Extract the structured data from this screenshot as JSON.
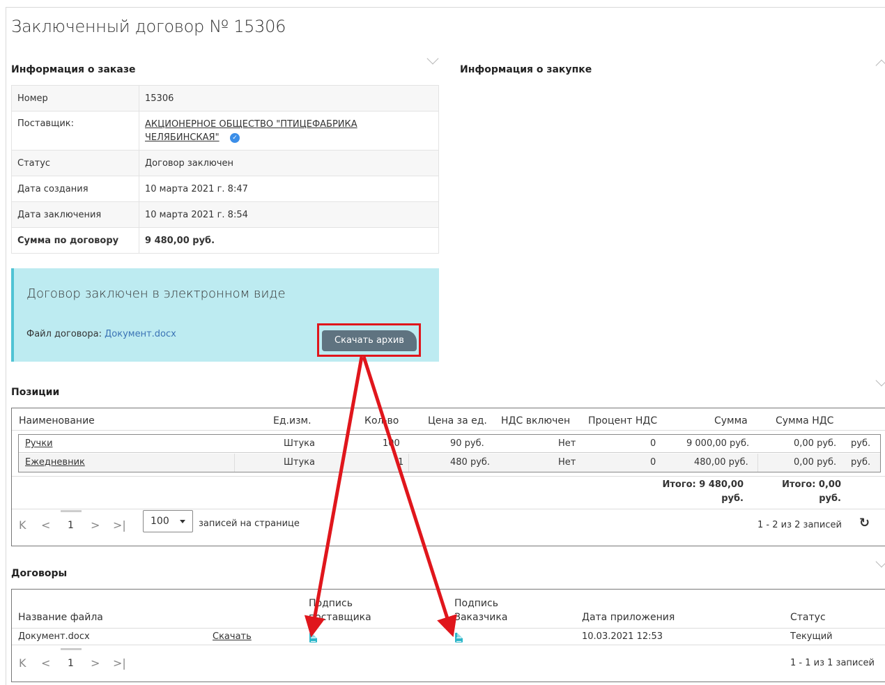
{
  "page": {
    "title": "Заключенный договор № 15306"
  },
  "order_info": {
    "title": "Информация о заказе",
    "rows": [
      {
        "label": "Номер",
        "value": "15306"
      },
      {
        "label": "Поставщик:",
        "value": "АКЦИОНЕРНОЕ ОБЩЕСТВО \"ПТИЦЕФАБРИКА ЧЕЛЯБИНСКАЯ\""
      },
      {
        "label": "Статус",
        "value": "Договор заключен"
      },
      {
        "label": "Дата создания",
        "value": "10 марта 2021 г. 8:47"
      },
      {
        "label": "Дата заключения",
        "value": "10 марта 2021 г. 8:54"
      },
      {
        "label": "Сумма по договору",
        "value": "9 480,00 руб."
      }
    ]
  },
  "purchase_info": {
    "title": "Информация о закупке"
  },
  "econtract": {
    "heading": "Договор заключен в электронном виде",
    "file_label": "Файл договора:",
    "file_name": "Документ.docx",
    "download_archive": "Скачать архив"
  },
  "positions": {
    "title": "Позиции",
    "columns": [
      "Наименование",
      "Ед.изм.",
      "Кол-во",
      "Цена за ед.",
      "НДС включен",
      "Процент НДС",
      "Сумма",
      "Сумма НДС"
    ],
    "rows": [
      {
        "name": "Ручки",
        "unit": "Штука",
        "qty": "100",
        "price": "90 руб.",
        "vat_included": "Нет",
        "vat_percent": "0",
        "sum": "9 000,00 руб.",
        "vat_sum": "0,00 руб.",
        "extra": "руб."
      },
      {
        "name": "Ежедневник",
        "unit": "Штука",
        "qty": "1",
        "price": "480 руб.",
        "vat_included": "Нет",
        "vat_percent": "0",
        "sum": "480,00 руб.",
        "vat_sum": "0,00 руб.",
        "extra": "руб."
      }
    ],
    "total_sum_line1": "Итого: 9 480,00",
    "total_sum_line2": "руб.",
    "total_vat_line1": "Итого: 0,00",
    "total_vat_line2": "руб.",
    "pager": {
      "page": "1",
      "page_size": "100",
      "per_page_label": "записей на странице",
      "records": "1 - 2 из 2 записей"
    }
  },
  "contracts": {
    "title": "Договоры",
    "columns": {
      "file_name": "Название файла",
      "supplier_sig_1": "Подпись",
      "supplier_sig_2": "поставщика",
      "customer_sig_1": "Подпись",
      "customer_sig_2": "Заказчика",
      "date": "Дата приложения",
      "status": "Статус"
    },
    "row": {
      "file_name": "Документ.docx",
      "download": "Скачать",
      "date": "10.03.2021 12:53",
      "status": "Текущий"
    },
    "pager": {
      "page": "1",
      "records": "1 - 1 из 1 записей"
    }
  },
  "colors": {
    "annotation_red": "#e0161c",
    "info_box": "#bdebf1",
    "button": "#5f7380"
  }
}
